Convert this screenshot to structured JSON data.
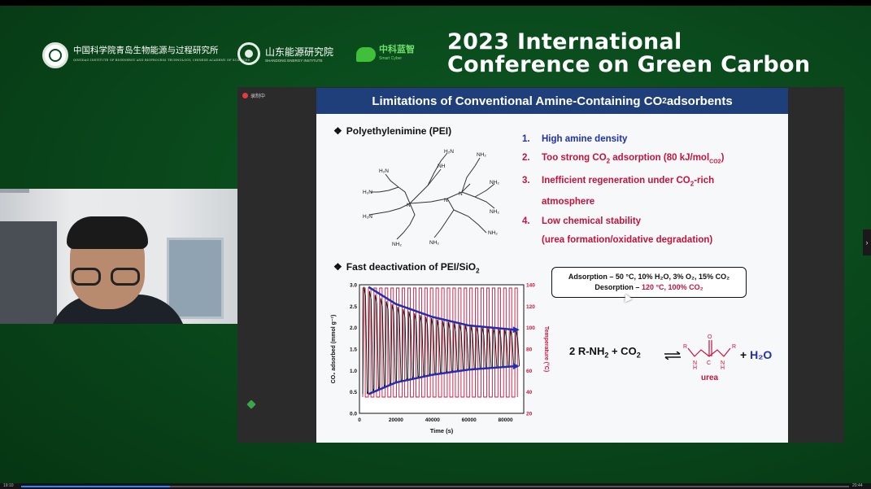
{
  "conference": {
    "title_line1": "2023 International",
    "title_line2": "Conference on Green Carbon"
  },
  "logos": {
    "qibebt_cn": "中国科学院青岛生物能源与过程研究所",
    "qibebt_en": "QINGDAO INSTITUTE OF BIOENERGY AND BIOPROCESS TECHNOLOGY, CHINESE ACADEMY OF SCIENCES",
    "sdei_cn": "山东能源研究院",
    "sdei_en": "SHANDONG ENERGY INSTITUTE",
    "zk_cn": "中科蓝智",
    "zk_en": "Smart Cyber"
  },
  "share": {
    "recording_label": "录制中"
  },
  "slide": {
    "title_pre": "Limitations of Conventional Amine-Containing CO",
    "title_sub": "2",
    "title_post": " adsorbents",
    "bullet1": "Polyethylenimine (PEI)",
    "bullet2_pre": "Fast deactivation of PEI/SiO",
    "bullet2_sub": "2",
    "list": [
      {
        "num": "1.",
        "text": "High amine density"
      },
      {
        "num": "2.",
        "text_pre": "Too strong CO",
        "sub": "2",
        "text_mid": " adsorption (80 kJ/mol",
        "sub2": "CO2",
        "text_post": ")"
      },
      {
        "num": "3.",
        "text_pre": "Inefficient regeneration under CO",
        "sub": "2",
        "text_post": "-rich",
        "cont": "atmosphere"
      },
      {
        "num": "4.",
        "text": "Low chemical stability",
        "cont": "(urea formation/oxidative degradation)"
      }
    ],
    "conditions": {
      "adsorption_label": "Adsorption – ",
      "adsorption_text": "50 °C, 10% H₂O, 3% O₂, 15% CO₂",
      "desorption_label": "Desorption – ",
      "desorption_text": "120 °C, 100% CO₂"
    },
    "reaction": {
      "left_pre": "2 R-NH",
      "left_sub": "2",
      "left_mid": " + CO",
      "left_sub2": "2",
      "product_label": "urea",
      "plus": "+ ",
      "water": "H₂O"
    },
    "pei_labels": [
      "H₂N",
      "NH",
      "N",
      "NH₂"
    ]
  },
  "chart_data": {
    "type": "line",
    "xlabel": "Time (s)",
    "ylabel": "CO₂ adsorbed (mmol g⁻¹)",
    "ylabel2": "Temperature (°C)",
    "xticks": [
      "0",
      "20000",
      "40000",
      "60000",
      "80000"
    ],
    "yticks": [
      "0.0",
      "0.5",
      "1.0",
      "1.5",
      "2.0",
      "2.5",
      "3.0"
    ],
    "y2ticks": [
      "20",
      "40",
      "60",
      "80",
      "100",
      "120",
      "140"
    ],
    "xlim": [
      0,
      90000
    ],
    "ylim": [
      0,
      3.0
    ],
    "y2lim": [
      20,
      140
    ],
    "series": [
      {
        "name": "adsorption_capacity_upper_trend",
        "x": [
          5000,
          20000,
          40000,
          60000,
          85000
        ],
        "values": [
          2.95,
          2.55,
          2.25,
          2.05,
          1.95
        ]
      },
      {
        "name": "adsorption_capacity_lower_trend",
        "x": [
          5000,
          20000,
          40000,
          60000,
          85000
        ],
        "values": [
          0.45,
          0.72,
          0.9,
          1.02,
          1.1
        ]
      }
    ],
    "cycles": 28,
    "colors": {
      "capacity": "#111111",
      "temperature": "#d2143c",
      "trend": "#1e2fb5"
    }
  },
  "playback": {
    "elapsed": "19:10",
    "total": "20:44",
    "progress": 0.18
  }
}
